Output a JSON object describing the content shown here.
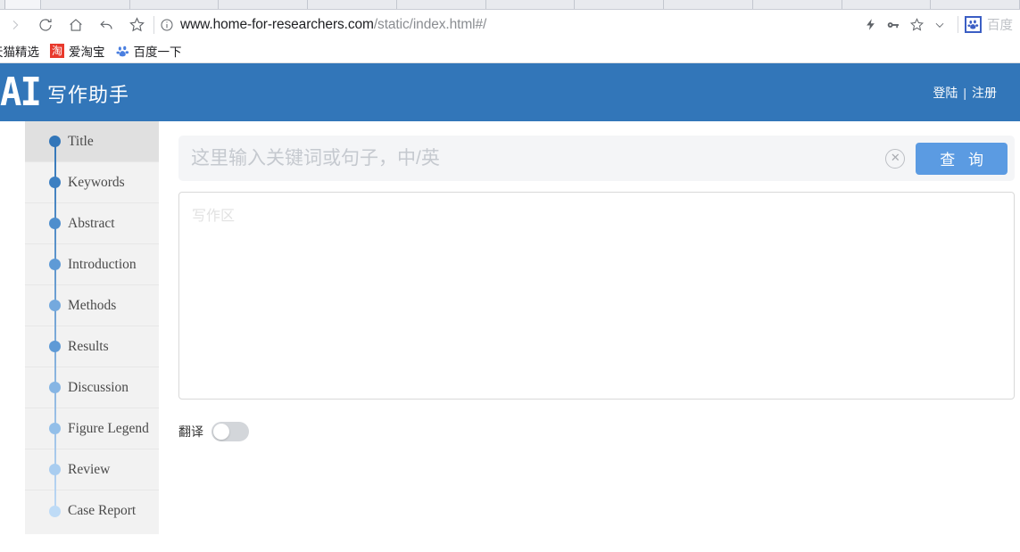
{
  "browser": {
    "nav": {
      "forward_icon": "forward-arrow-icon",
      "reload_icon": "reload-icon",
      "home_icon": "home-icon",
      "back_icon": "back-arrow-icon",
      "bookmark_star_icon": "star-icon"
    },
    "omnibox": {
      "info_icon": "info-circle-icon",
      "url_domain": "www.home-for-researchers.com",
      "url_path": "/static/index.html#/"
    },
    "toolbar_right": {
      "lightning_icon": "lightning-icon",
      "key_icon": "key-icon",
      "star_icon": "star-outline-icon",
      "chevron_icon": "chevron-down-icon",
      "extension_icon": "baidu-paw-icon",
      "extension_label": "百度"
    },
    "bookmarks": [
      {
        "label": "天猫精选",
        "icon": "tmall-icon"
      },
      {
        "label": "爱淘宝",
        "icon": "taobao-icon"
      },
      {
        "label": "百度一下",
        "icon": "baidu-paw-icon"
      }
    ]
  },
  "header": {
    "brand_mark": "AI",
    "brand_text": "写作助手",
    "login_label": "登陆",
    "separator": "|",
    "register_label": "注册",
    "background_color": "#3276b9"
  },
  "sidebar": {
    "items": [
      {
        "label": "Title",
        "dot_color": "#3276b9",
        "active": true
      },
      {
        "label": "Keywords",
        "dot_color": "#3d80c2",
        "active": false
      },
      {
        "label": "Abstract",
        "dot_color": "#4e8ecd",
        "active": false
      },
      {
        "label": "Introduction",
        "dot_color": "#5e9ad6",
        "active": false
      },
      {
        "label": "Methods",
        "dot_color": "#74a9de",
        "active": false
      },
      {
        "label": "Results",
        "dot_color": "#5e9ad6",
        "active": false
      },
      {
        "label": "Discussion",
        "dot_color": "#86b5e4",
        "active": false
      },
      {
        "label": "Figure Legend",
        "dot_color": "#93bfe9",
        "active": false
      },
      {
        "label": "Review",
        "dot_color": "#a9cdf0",
        "active": false
      },
      {
        "label": "Case Report",
        "dot_color": "#bedbf6",
        "active": false
      }
    ]
  },
  "main": {
    "search": {
      "value": "",
      "placeholder": "这里输入关键词或句子，中/英",
      "clear_icon": "clear-circle-x-icon",
      "query_label": "查 询",
      "query_color": "#5b9be2"
    },
    "editor": {
      "value": "",
      "placeholder": "写作区"
    },
    "translate": {
      "label": "翻译",
      "state": "off"
    }
  }
}
